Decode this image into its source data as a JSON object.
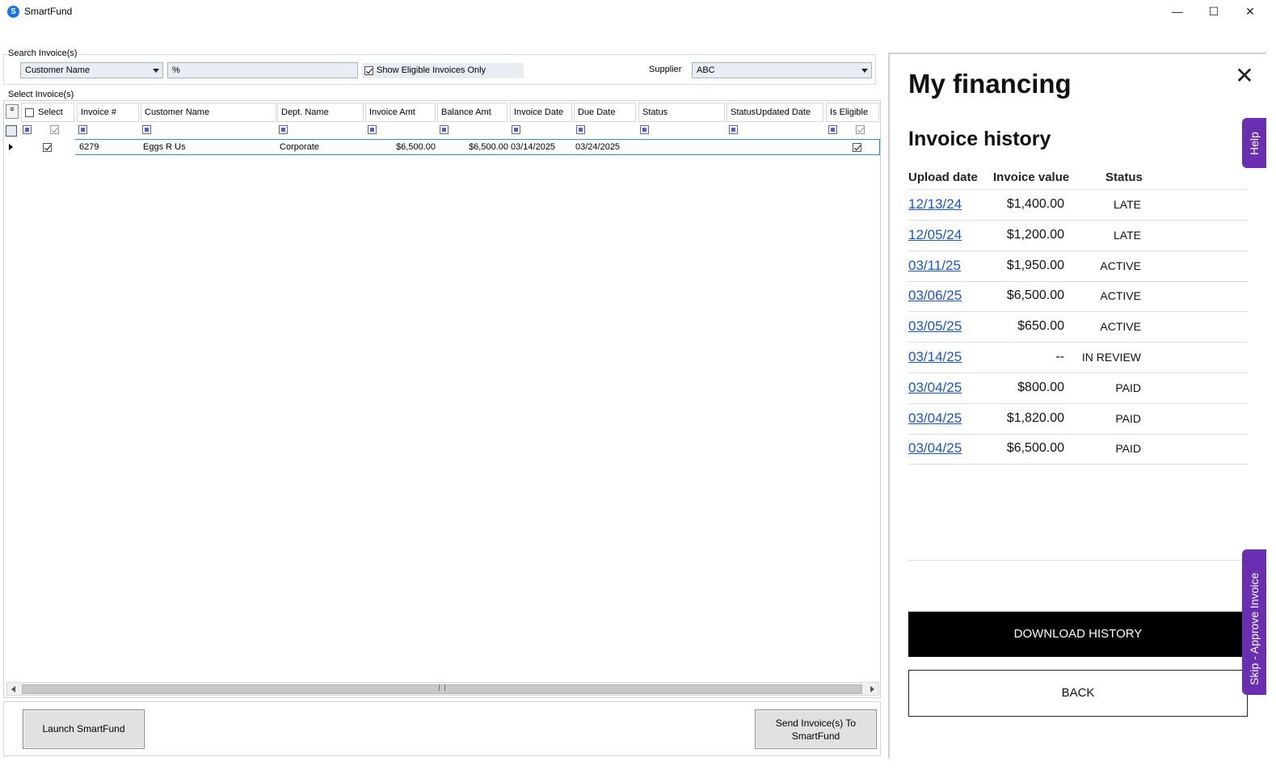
{
  "window": {
    "app_icon": "smartfund-logo-icon",
    "title": "SmartFund",
    "minimize_glyph": "—",
    "maximize_glyph": "☐",
    "close_glyph": "✕"
  },
  "search": {
    "group_label": "Search Invoice(s)",
    "field_combo": "Customer Name",
    "search_text": "%",
    "show_eligible_label": "Show Eligible Invoices Only",
    "show_eligible_checked": true,
    "supplier_label": "Supplier",
    "supplier_value": "ABC"
  },
  "grid": {
    "group_label": "Select Invoice(s)",
    "columns": [
      "Select",
      "Invoice #",
      "Customer Name",
      "Dept. Name",
      "Invoice Amt",
      "Balance Amt",
      "Invoice Date",
      "Due Date",
      "Status",
      "StatusUpdated Date",
      "Is Eligible"
    ],
    "rows": [
      {
        "selected": true,
        "invoice": "6279",
        "customer": "Eggs R Us",
        "dept": "Corporate",
        "invoice_amt": "$6,500.00",
        "balance_amt": "$6,500.00",
        "invoice_date": "03/14/2025",
        "due_date": "03/24/2025",
        "status": "",
        "status_updated": "",
        "is_eligible": true
      }
    ]
  },
  "buttons": {
    "launch": "Launch SmartFund",
    "send_line1": "Send Invoice(s) To",
    "send_line2": "SmartFund"
  },
  "panel": {
    "title": "My financing",
    "close_glyph": "✕",
    "subtitle": "Invoice history",
    "headers": {
      "date": "Upload date",
      "value": "Invoice value",
      "status": "Status"
    },
    "history": [
      {
        "date": "12/13/24",
        "value": "$1,400.00",
        "status": "LATE"
      },
      {
        "date": "12/05/24",
        "value": "$1,200.00",
        "status": "LATE"
      },
      {
        "date": "03/11/25",
        "value": "$1,950.00",
        "status": "ACTIVE"
      },
      {
        "date": "03/06/25",
        "value": "$6,500.00",
        "status": "ACTIVE"
      },
      {
        "date": "03/05/25",
        "value": "$650.00",
        "status": "ACTIVE"
      },
      {
        "date": "03/14/25",
        "value": "--",
        "status": "IN REVIEW"
      },
      {
        "date": "03/04/25",
        "value": "$800.00",
        "status": "PAID"
      },
      {
        "date": "03/04/25",
        "value": "$1,820.00",
        "status": "PAID"
      },
      {
        "date": "03/04/25",
        "value": "$6,500.00",
        "status": "PAID"
      }
    ],
    "download_label": "DOWNLOAD HISTORY",
    "back_label": "BACK"
  },
  "side_tabs": {
    "help": "Help",
    "skip": "Skip - Approve Invoice"
  },
  "colors": {
    "accent_purple": "#6a2fb0",
    "link_blue": "#1a56c4",
    "selection_blue": "#2b8fd6"
  }
}
